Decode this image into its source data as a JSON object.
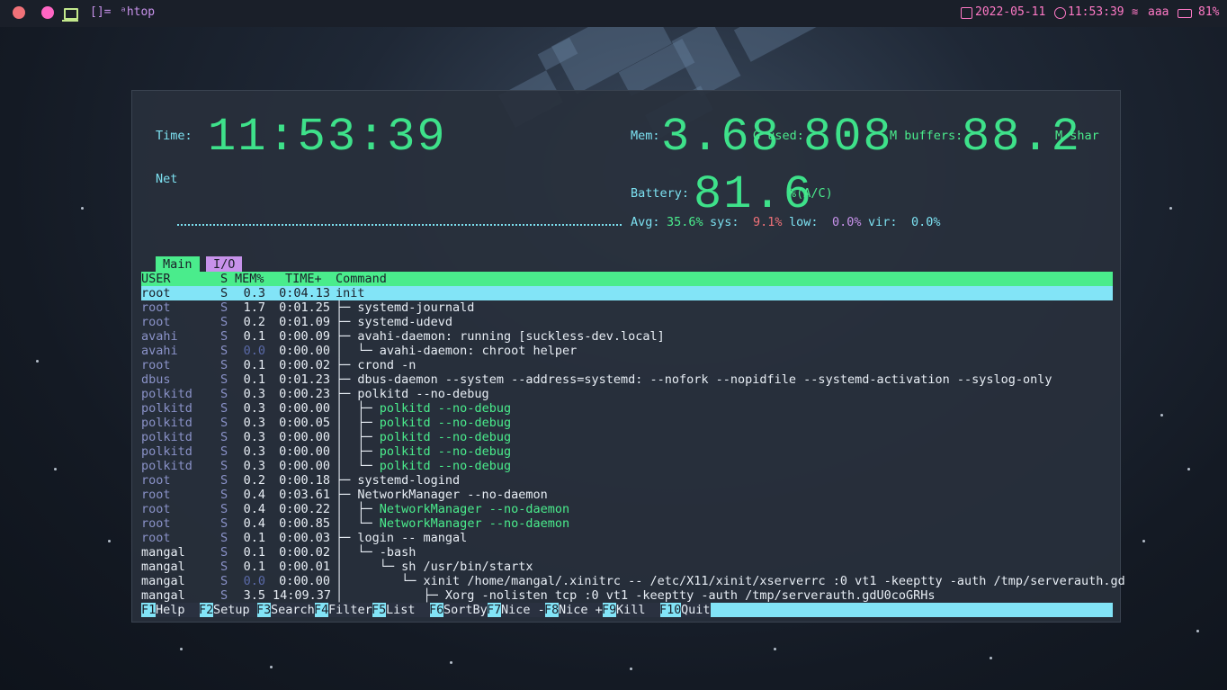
{
  "topbar": {
    "layout": "[]=",
    "window_title": "ᵃhtop",
    "date": "2022-05-11",
    "time": "11:53:39",
    "wifi": "aaa",
    "battery": "81%"
  },
  "htop_meters": {
    "time_label": "Time:",
    "time_value": "11:53:39",
    "net_label": "Net",
    "mem_label": "Mem:",
    "mem_value": "3.68",
    "mem_used_label": "G used:",
    "mem_used_value": "808",
    "buffers_label": "M buffers:",
    "buffers_value": "88.2",
    "shar_label": "M shar",
    "battery_label": "Battery:",
    "battery_value": "81.6",
    "battery_unit": "%(A/C)",
    "avg_label": "Avg:",
    "avg_value": "35.6%",
    "sys_label": "sys:",
    "sys_value": "9.1%",
    "low_label": "low:",
    "low_value": "0.0%",
    "vir_label": "vir:",
    "vir_value": "0.0%"
  },
  "tabs": [
    "Main",
    "I/O"
  ],
  "columns": {
    "user": "USER",
    "s": "S",
    "mem": "MEM%",
    "time": "TIME+",
    "command": "Command"
  },
  "selected": {
    "user": "root",
    "s": "S",
    "mem": "0.3",
    "time": "0:04.13",
    "command": "init"
  },
  "rows": [
    {
      "user": "root",
      "s": "S",
      "mem": "1.7",
      "time": "0:01.25",
      "tree": "├─ ",
      "cmd": "systemd-journald",
      "type": "proc",
      "udim": true
    },
    {
      "user": "root",
      "s": "S",
      "mem": "0.2",
      "time": "0:01.09",
      "tree": "├─ ",
      "cmd": "systemd-udevd",
      "type": "proc",
      "udim": true
    },
    {
      "user": "avahi",
      "s": "S",
      "mem": "0.1",
      "time": "0:00.09",
      "tree": "├─ ",
      "cmd": "avahi-daemon: running [suckless-dev.local]",
      "type": "proc",
      "udim": true
    },
    {
      "user": "avahi",
      "s": "S",
      "mem": "0.0",
      "time": "0:00.00",
      "tree": "│  └─ ",
      "cmd": "avahi-daemon: chroot helper",
      "type": "proc",
      "udim": true,
      "zero": true
    },
    {
      "user": "root",
      "s": "S",
      "mem": "0.1",
      "time": "0:00.02",
      "tree": "├─ ",
      "cmd": "crond -n",
      "type": "proc",
      "udim": true
    },
    {
      "user": "dbus",
      "s": "S",
      "mem": "0.1",
      "time": "0:01.23",
      "tree": "├─ ",
      "cmd": "dbus-daemon --system --address=systemd: --nofork --nopidfile --systemd-activation --syslog-only",
      "type": "proc",
      "udim": true
    },
    {
      "user": "polkitd",
      "s": "S",
      "mem": "0.3",
      "time": "0:00.23",
      "tree": "├─ ",
      "cmd": "polkitd --no-debug",
      "type": "proc",
      "udim": true
    },
    {
      "user": "polkitd",
      "s": "S",
      "mem": "0.3",
      "time": "0:00.00",
      "tree": "│  ├─ ",
      "cmd": "polkitd --no-debug",
      "type": "thread",
      "udim": true
    },
    {
      "user": "polkitd",
      "s": "S",
      "mem": "0.3",
      "time": "0:00.05",
      "tree": "│  ├─ ",
      "cmd": "polkitd --no-debug",
      "type": "thread",
      "udim": true
    },
    {
      "user": "polkitd",
      "s": "S",
      "mem": "0.3",
      "time": "0:00.00",
      "tree": "│  ├─ ",
      "cmd": "polkitd --no-debug",
      "type": "thread",
      "udim": true
    },
    {
      "user": "polkitd",
      "s": "S",
      "mem": "0.3",
      "time": "0:00.00",
      "tree": "│  ├─ ",
      "cmd": "polkitd --no-debug",
      "type": "thread",
      "udim": true
    },
    {
      "user": "polkitd",
      "s": "S",
      "mem": "0.3",
      "time": "0:00.00",
      "tree": "│  └─ ",
      "cmd": "polkitd --no-debug",
      "type": "thread",
      "udim": true
    },
    {
      "user": "root",
      "s": "S",
      "mem": "0.2",
      "time": "0:00.18",
      "tree": "├─ ",
      "cmd": "systemd-logind",
      "type": "proc",
      "udim": true
    },
    {
      "user": "root",
      "s": "S",
      "mem": "0.4",
      "time": "0:03.61",
      "tree": "├─ ",
      "cmd": "NetworkManager --no-daemon",
      "type": "proc",
      "udim": true
    },
    {
      "user": "root",
      "s": "S",
      "mem": "0.4",
      "time": "0:00.22",
      "tree": "│  ├─ ",
      "cmd": "NetworkManager --no-daemon",
      "type": "thread",
      "udim": true
    },
    {
      "user": "root",
      "s": "S",
      "mem": "0.4",
      "time": "0:00.85",
      "tree": "│  └─ ",
      "cmd": "NetworkManager --no-daemon",
      "type": "thread",
      "udim": true
    },
    {
      "user": "root",
      "s": "S",
      "mem": "0.1",
      "time": "0:00.03",
      "tree": "├─ ",
      "cmd": "login -- mangal",
      "type": "proc",
      "udim": true
    },
    {
      "user": "mangal",
      "s": "S",
      "mem": "0.1",
      "time": "0:00.02",
      "tree": "│  └─ ",
      "cmd": "-bash",
      "type": "proc",
      "udim": false
    },
    {
      "user": "mangal",
      "s": "S",
      "mem": "0.1",
      "time": "0:00.01",
      "tree": "│     └─ ",
      "cmd": "sh /usr/bin/startx",
      "type": "proc",
      "udim": false
    },
    {
      "user": "mangal",
      "s": "S",
      "mem": "0.0",
      "time": "0:00.00",
      "tree": "│        └─ ",
      "cmd": "xinit /home/mangal/.xinitrc -- /etc/X11/xinit/xserverrc :0 vt1 -keeptty -auth /tmp/serverauth.gd",
      "type": "proc",
      "udim": false,
      "zero": true
    },
    {
      "user": "mangal",
      "s": "S",
      "mem": "3.5",
      "time": "14:09.37",
      "tree": "│           ├─ ",
      "cmd": "Xorg -nolisten tcp :0 vt1 -keeptty -auth /tmp/serverauth.gdU0coGRHs",
      "type": "proc",
      "udim": false
    }
  ],
  "fkeys": [
    {
      "key": "F1",
      "label": "Help  "
    },
    {
      "key": "F2",
      "label": "Setup "
    },
    {
      "key": "F3",
      "label": "Search"
    },
    {
      "key": "F4",
      "label": "Filter"
    },
    {
      "key": "F5",
      "label": "List  "
    },
    {
      "key": "F6",
      "label": "SortBy"
    },
    {
      "key": "F7",
      "label": "Nice -"
    },
    {
      "key": "F8",
      "label": "Nice +"
    },
    {
      "key": "F9",
      "label": "Kill  "
    },
    {
      "key": "F10",
      "label": "Quit"
    }
  ]
}
